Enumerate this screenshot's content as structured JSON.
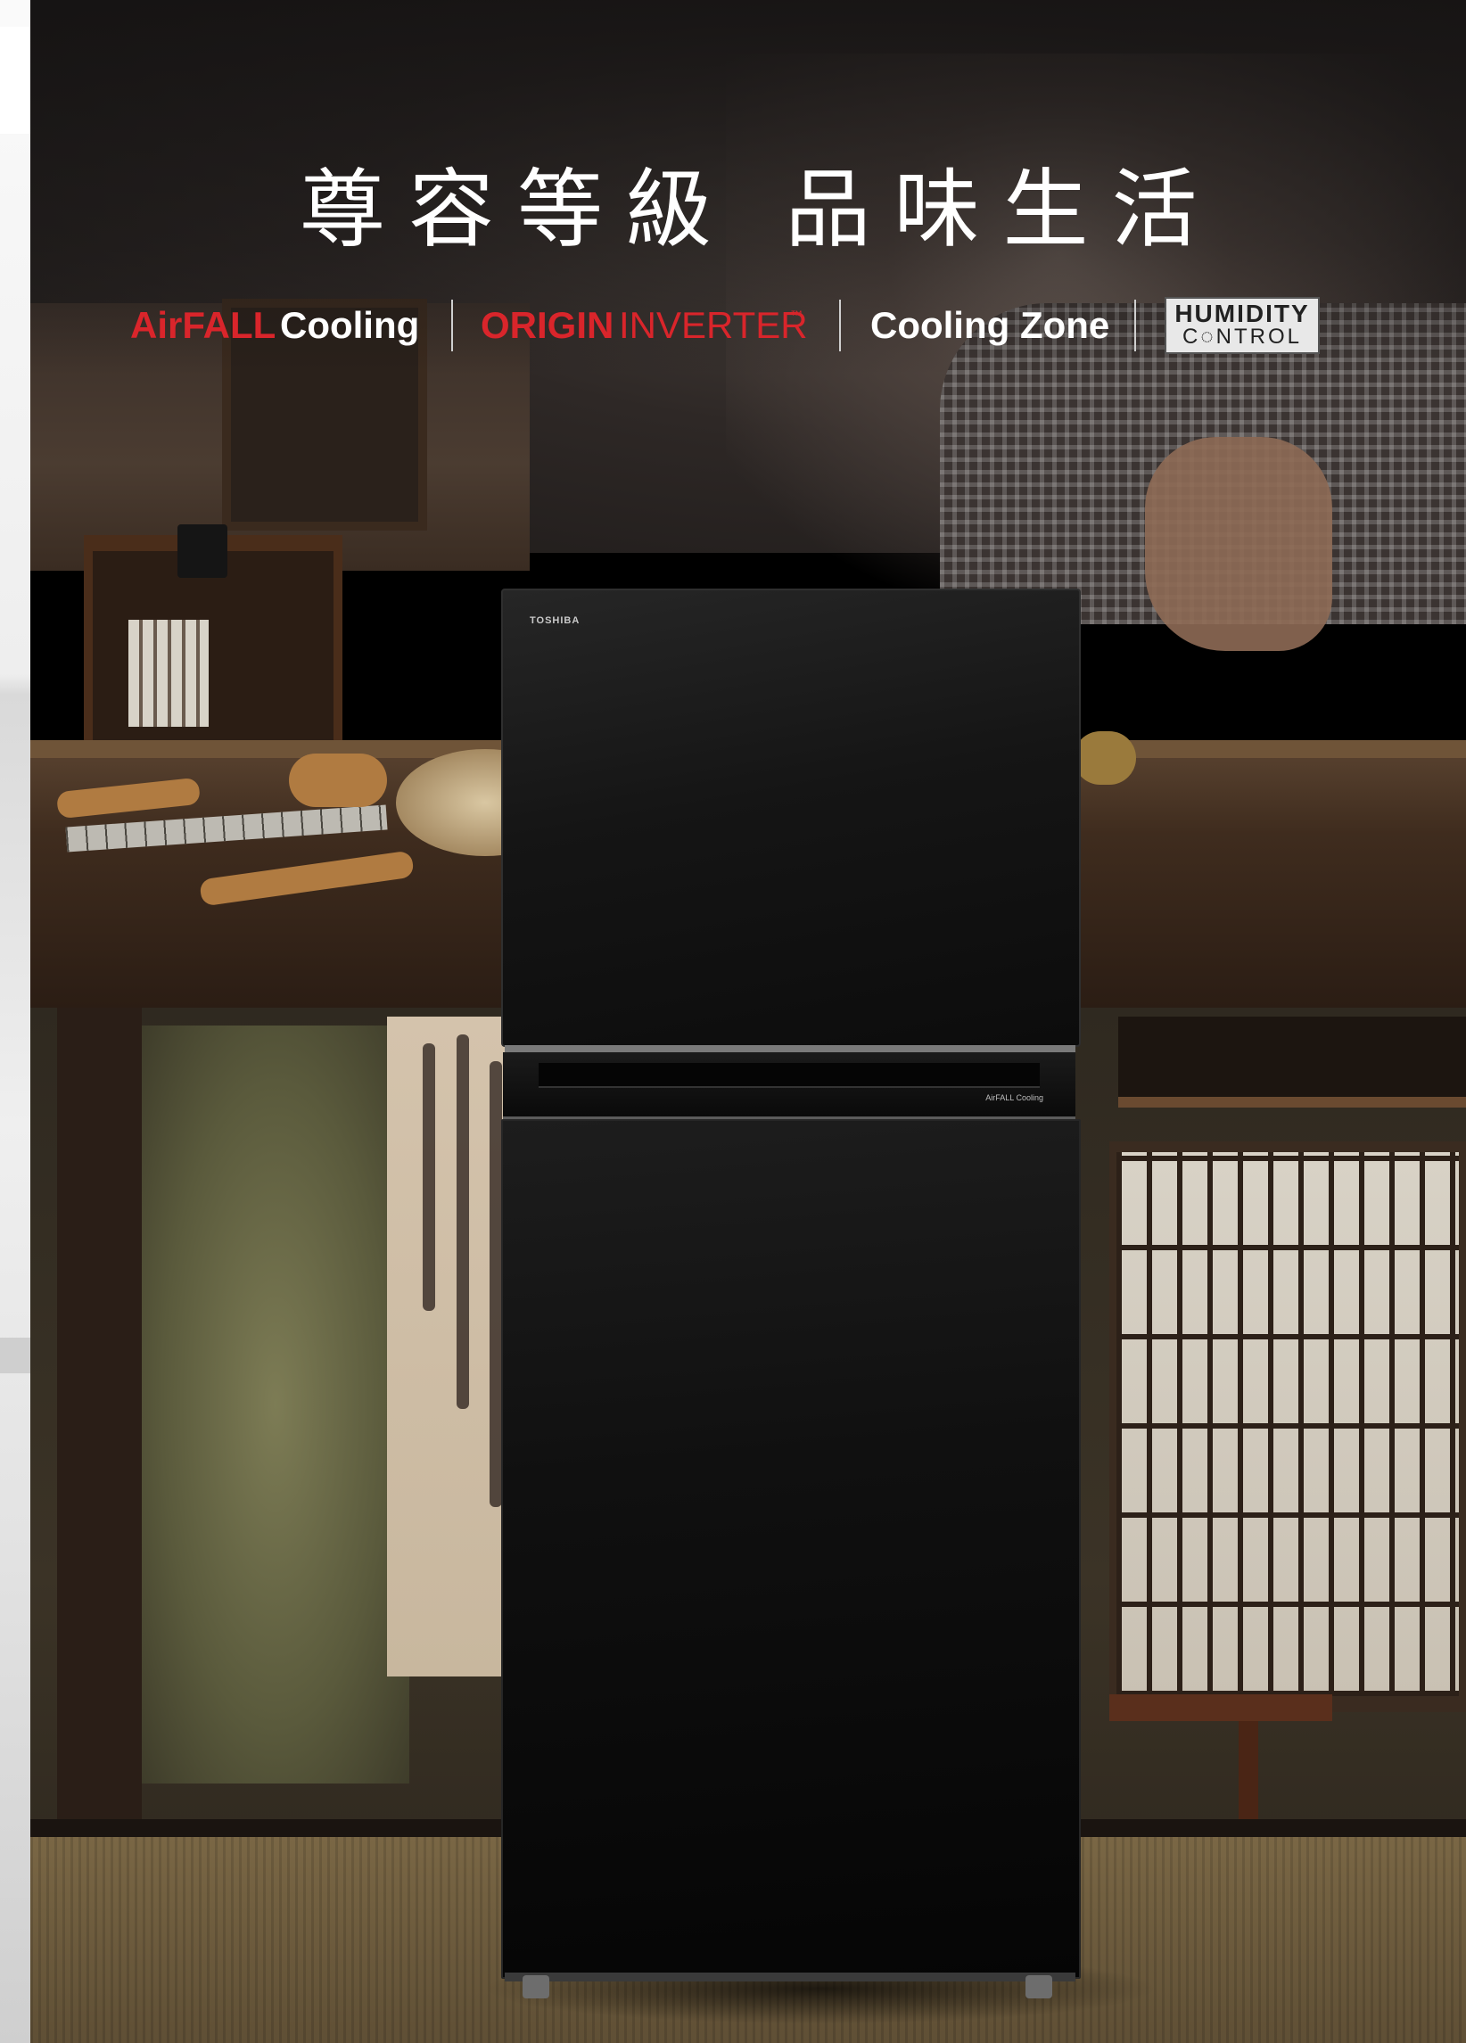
{
  "headline": "尊容等級  品味生活",
  "features": {
    "airfall_red": "AirFALL",
    "airfall_white": "Cooling",
    "origin_bold": "ORIGIN",
    "origin_thin": "INVERTER",
    "origin_tm": "™",
    "cooling_zone": "Cooling Zone",
    "humidity_line1": "HUMIDITY",
    "humidity_line2": "C◌NTROL"
  },
  "fridge": {
    "brand": "TOSHIBA",
    "model_label": "AirFALL Cooling"
  },
  "colors": {
    "brand_red": "#d9252b",
    "fridge_black": "#0c0c0c"
  }
}
